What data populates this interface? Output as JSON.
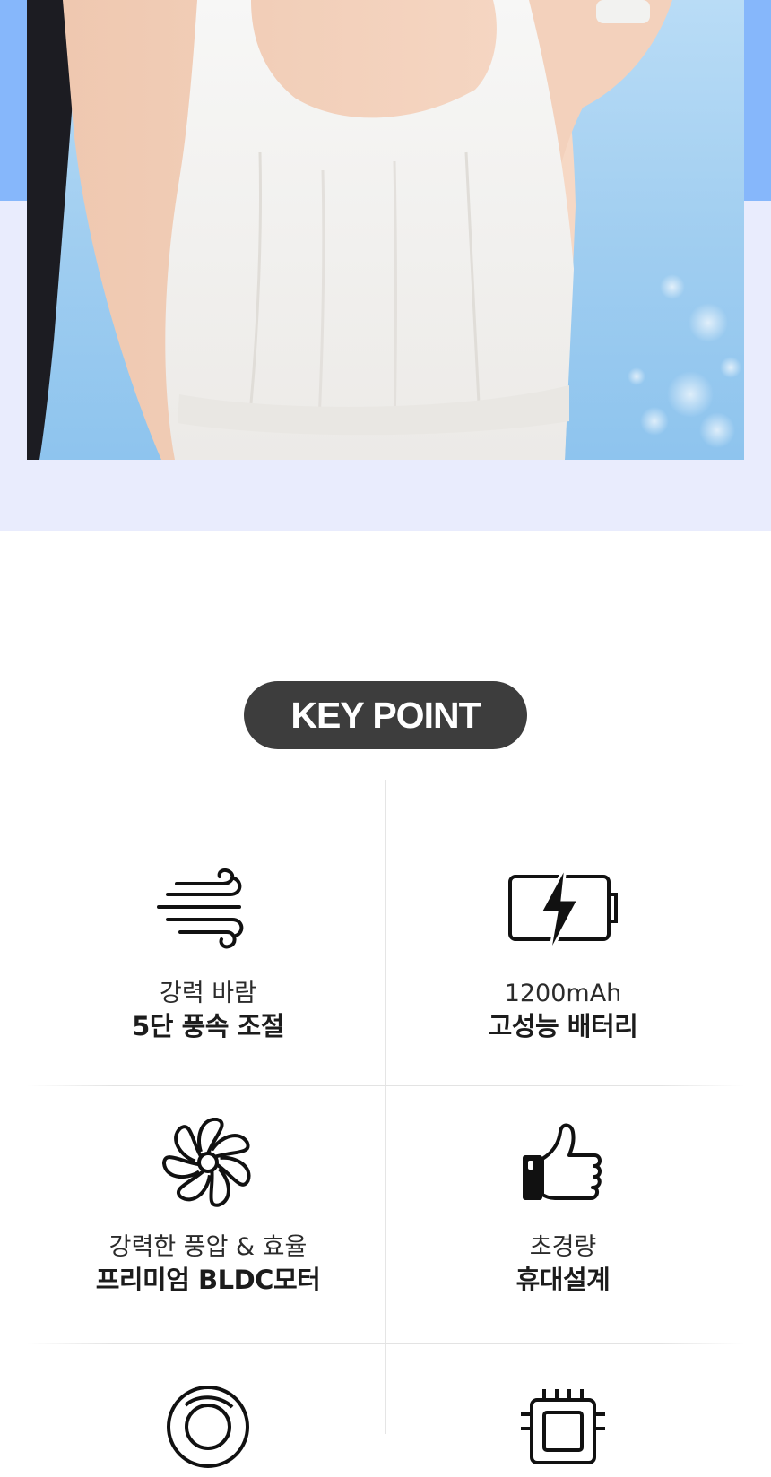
{
  "hero": {
    "photo_alt": "Woman in white dress holding a handheld fan"
  },
  "key_point": {
    "title": "KEY POINT"
  },
  "features": [
    {
      "icon": "wind-icon",
      "line1": "강력 바람",
      "line2": "5단 풍속 조절"
    },
    {
      "icon": "battery-icon",
      "line1": "1200mAh",
      "line2": "고성능 배터리"
    },
    {
      "icon": "fan-blade-icon",
      "line1": "강력한 풍압 & 효율",
      "line2": "프리미엄 BLDC모터"
    },
    {
      "icon": "thumbs-up-icon",
      "line1": "초경량",
      "line2": "휴대설계"
    },
    {
      "icon": "ring-icon",
      "line1": "",
      "line2": ""
    },
    {
      "icon": "chip-icon",
      "line1": "",
      "line2": ""
    }
  ],
  "colors": {
    "hero_band": "#86b7fb",
    "hero_bg": "#e9ecfd",
    "pill_bg": "#3d3d3d"
  }
}
